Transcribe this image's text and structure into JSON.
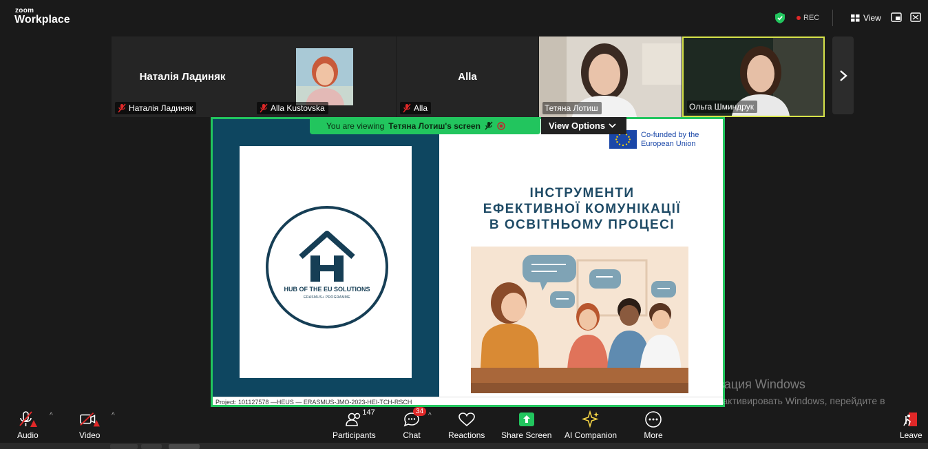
{
  "app": {
    "brand_small": "zoom",
    "brand_large": "Workplace"
  },
  "topbar": {
    "rec_label": "REC",
    "view_label": "View"
  },
  "thumbnails": [
    {
      "center_name": "Наталія Ладиняк",
      "label": "Наталія Ладиняк",
      "muted": true
    },
    {
      "label": "Alla Kustovska",
      "muted": true
    },
    {
      "center_name": "Alla",
      "label": "Alla",
      "muted": true
    },
    {
      "label": "Тетяна Лотиш",
      "muted": false
    },
    {
      "label": "Ольга Шминдрук",
      "muted": false,
      "active_speaker": true
    }
  ],
  "share": {
    "viewing_prefix": "You are viewing",
    "viewing_name": "Тетяна Лотиш's screen",
    "view_options": "View Options"
  },
  "slide": {
    "logo_title": "HUB OF THE EU SOLUTIONS",
    "logo_subtitle": "ERASMUS+ PROGRAMME",
    "eu_line1": "Co-funded by the",
    "eu_line2": "European Union",
    "title_line1": "ІНСТРУМЕНТИ",
    "title_line2": "ЕФЕКТИВНОЇ КОМУНІКАЦІЇ",
    "title_line3": "В ОСВІТНЬОМУ ПРОЦЕСІ",
    "footer": "Project: 101127578 —HEUS — ERASMUS-JMO-2023-HEI-TCH-RSCH"
  },
  "watermark": {
    "line1": "Активация Windows",
    "line2": "Чтобы активировать Windows, перейдите в раздел \"Параметры\"."
  },
  "toolbar": {
    "audio": "Audio",
    "video": "Video",
    "participants": "Participants",
    "participants_count": "147",
    "chat": "Chat",
    "chat_badge": "34",
    "reactions": "Reactions",
    "share_screen": "Share Screen",
    "ai_companion": "AI Companion",
    "more": "More",
    "leave": "Leave"
  },
  "colors": {
    "share_border": "#22c55e",
    "slide_navy": "#0e4660",
    "eu_blue": "#1a47a8",
    "alert_red": "#e02828"
  }
}
